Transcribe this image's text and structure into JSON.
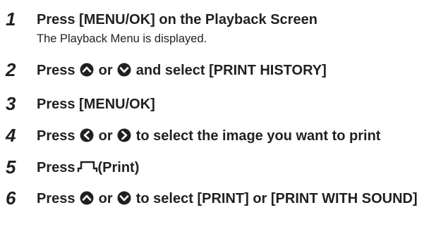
{
  "steps": [
    {
      "number": "1",
      "title": "Press [MENU/OK] on the Playback Screen",
      "description": "The Playback Menu is displayed."
    },
    {
      "number": "2",
      "prefix": "Press",
      "middle": "or",
      "suffix": "and select [PRINT HISTORY]",
      "icons": [
        "up-arrow-icon",
        "down-arrow-icon"
      ]
    },
    {
      "number": "3",
      "title": "Press [MENU/OK]"
    },
    {
      "number": "4",
      "prefix": "Press",
      "middle": "or",
      "suffix": "to select the image you want to print",
      "icons": [
        "left-arrow-icon",
        "right-arrow-icon"
      ]
    },
    {
      "number": "5",
      "prefix": "Press",
      "suffix": "(Print)",
      "icons": [
        "print-icon"
      ]
    },
    {
      "number": "6",
      "prefix": "Press",
      "middle": "or",
      "suffix": "to select [PRINT] or [PRINT WITH SOUND]",
      "icons": [
        "up-arrow-icon",
        "down-arrow-icon"
      ]
    }
  ],
  "colors": {
    "text": "#231f20",
    "icon_fill": "#231f20"
  }
}
